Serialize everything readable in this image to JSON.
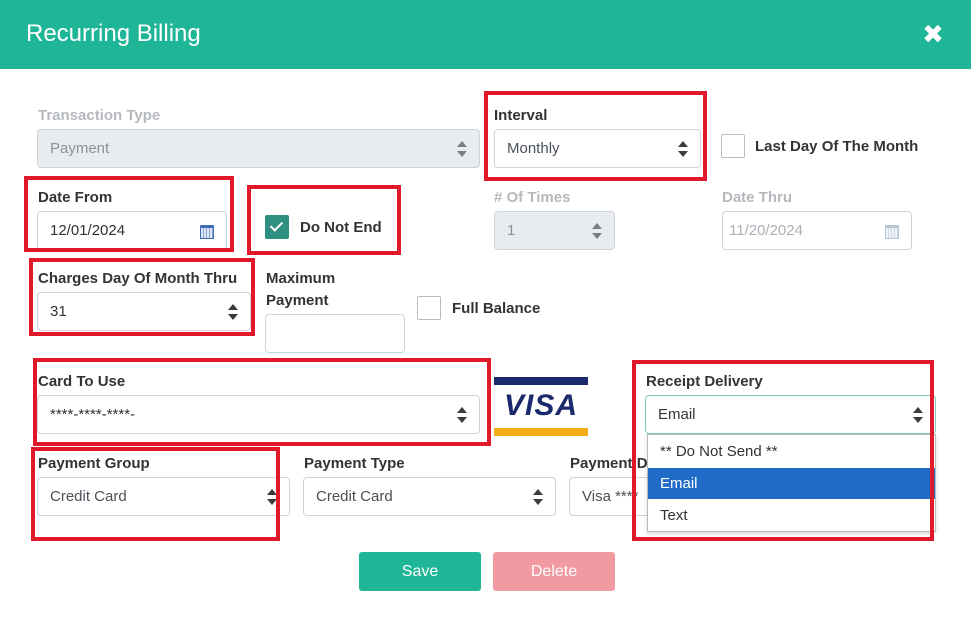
{
  "dialog": {
    "title": "Recurring Billing",
    "close_icon": "close-icon"
  },
  "transaction_type": {
    "label": "Transaction Type",
    "value": "Payment"
  },
  "interval": {
    "label": "Interval",
    "value": "Monthly"
  },
  "last_day_of_month": {
    "label": "Last Day Of The Month",
    "checked": false
  },
  "date_from": {
    "label": "Date From",
    "value": "12/01/2024"
  },
  "do_not_end": {
    "label": "Do Not End",
    "checked": true
  },
  "num_times": {
    "label": "# Of Times",
    "value": "1"
  },
  "date_thru": {
    "label": "Date Thru",
    "value": "11/20/2024"
  },
  "charges_day": {
    "label": "Charges Day Of Month Thru",
    "value": "31"
  },
  "maximum_payment": {
    "label_line1": "Maximum",
    "label_line2": "Payment",
    "value": ""
  },
  "full_balance": {
    "label": "Full Balance",
    "checked": false
  },
  "card_to_use": {
    "label": "Card To Use",
    "value": "****-****-****-"
  },
  "card_brand": "VISA",
  "receipt_delivery": {
    "label": "Receipt Delivery",
    "value": "Email",
    "options": [
      "** Do Not Send **",
      "Email",
      "Text"
    ],
    "selected_index": 1
  },
  "payment_group": {
    "label": "Payment Group",
    "value": "Credit Card"
  },
  "payment_type": {
    "label": "Payment Type",
    "value": "Credit Card"
  },
  "payment_d": {
    "label": "Payment D",
    "value": "Visa ****"
  },
  "buttons": {
    "save": "Save",
    "delete": "Delete"
  },
  "colors": {
    "header": "#1fb597",
    "highlight": "#e0182a",
    "selected_option": "#1f6bc7",
    "delete": "#f19aa2"
  }
}
